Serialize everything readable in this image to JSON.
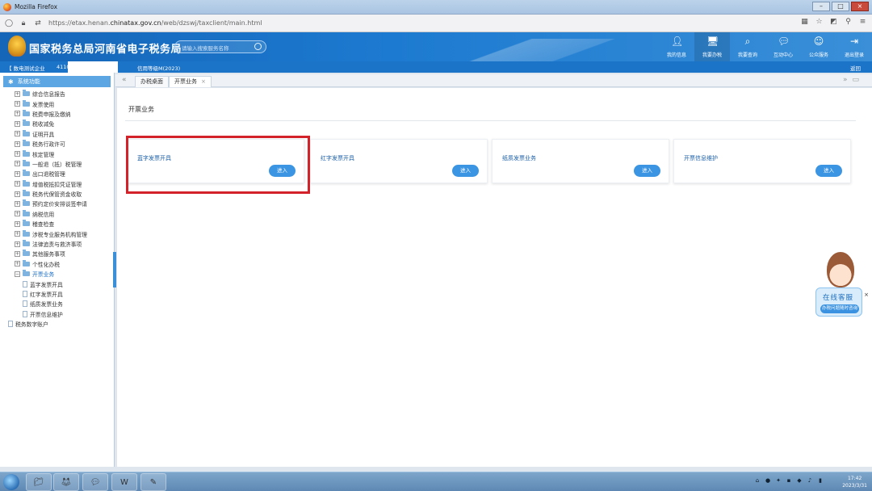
{
  "window": {
    "title": "Mozilla Firefox"
  },
  "browser": {
    "url_prefix": "https://etax.henan.",
    "url_domain": "chinatax.gov.cn",
    "url_suffix": "/web/dzswj/taxclient/main.html"
  },
  "header": {
    "site_title": "国家税务总局河南省电子税务局",
    "search_placeholder": "请输入搜索服务名称",
    "nav": [
      {
        "label": "我的信息",
        "icon": "user-icon"
      },
      {
        "label": "我要办税",
        "icon": "monitor-icon"
      },
      {
        "label": "我要查询",
        "icon": "search-doc-icon"
      },
      {
        "label": "互动中心",
        "icon": "chat-icon"
      },
      {
        "label": "公众服务",
        "icon": "service-icon"
      },
      {
        "label": "退出登录",
        "icon": "logout-icon"
      }
    ]
  },
  "info_bar": {
    "company": "【 数电测试企业",
    "tax_id_prefix": "4110",
    "credit_level": "信用等级M(2023)",
    "back": "返回"
  },
  "sidebar": {
    "title": "系统功能",
    "items": [
      {
        "label": "综合信息报告"
      },
      {
        "label": "发票使用"
      },
      {
        "label": "税费申报及缴纳"
      },
      {
        "label": "税收减免"
      },
      {
        "label": "证明开具"
      },
      {
        "label": "税务行政许可"
      },
      {
        "label": "核定管理"
      },
      {
        "label": "一般退（抵）税管理"
      },
      {
        "label": "出口退税管理"
      },
      {
        "label": "增值税抵扣凭证管理"
      },
      {
        "label": "税务代保管资金收取"
      },
      {
        "label": "预约定价安排谈签申请"
      },
      {
        "label": "纳税信用"
      },
      {
        "label": "稽查检查"
      },
      {
        "label": "涉税专业服务机构管理"
      },
      {
        "label": "法律追责与救济事项"
      },
      {
        "label": "其他服务事项"
      },
      {
        "label": "个性化办税"
      }
    ],
    "expanded": {
      "label": "开票业务",
      "children": [
        "蓝字发票开具",
        "红字发票开具",
        "纸质发票业务",
        "开票信息维护"
      ]
    },
    "last": "税务数字账户"
  },
  "tabs": [
    {
      "label": "办税桌面"
    },
    {
      "label": "开票业务",
      "close": "×"
    }
  ],
  "main": {
    "section_title": "开票业务",
    "cards": [
      {
        "label": "蓝字发票开具",
        "button": "进入"
      },
      {
        "label": "红字发票开具",
        "button": "进入"
      },
      {
        "label": "纸质发票业务",
        "button": "进入"
      },
      {
        "label": "开票信息维护",
        "button": "进入"
      }
    ]
  },
  "customer_service": {
    "title": "在线客服",
    "subtitle": "办税问题随时咨询",
    "close": "×"
  },
  "taskbar": {
    "time": "17:42",
    "date": "2023/3/31"
  },
  "colors": {
    "header_blue": "#1565b8",
    "button_blue": "#3b95e3",
    "highlight_red": "#d4222a"
  }
}
